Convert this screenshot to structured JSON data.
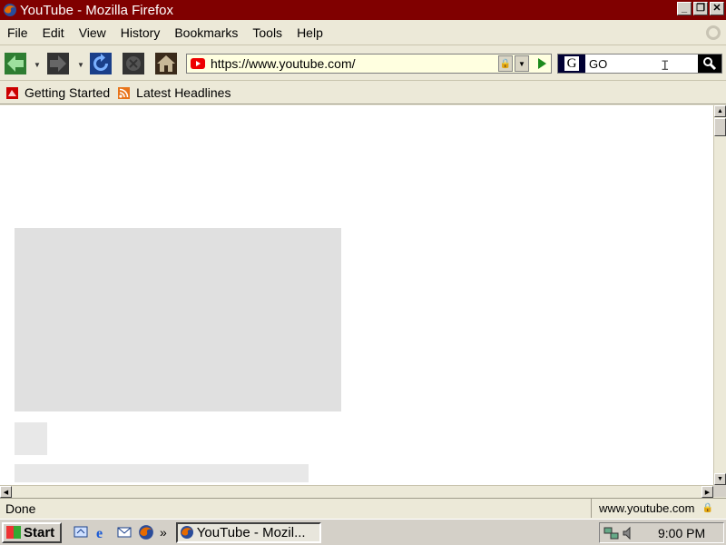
{
  "window": {
    "title": "YouTube - Mozilla Firefox"
  },
  "menu": {
    "items": [
      "File",
      "Edit",
      "View",
      "History",
      "Bookmarks",
      "Tools",
      "Help"
    ]
  },
  "navigation": {
    "url": "https://www.youtube.com/",
    "search_value": "GO"
  },
  "bookmarks": {
    "items": [
      "Getting Started",
      "Latest Headlines"
    ]
  },
  "status": {
    "text": "Done",
    "host": "www.youtube.com"
  },
  "taskbar": {
    "start_label": "Start",
    "task_label": "YouTube - Mozil...",
    "clock": "9:00 PM"
  },
  "colors": {
    "titlebar": "#800000",
    "urlbar_bg": "#ffffe0",
    "placeholder": "#e0e0e0"
  }
}
